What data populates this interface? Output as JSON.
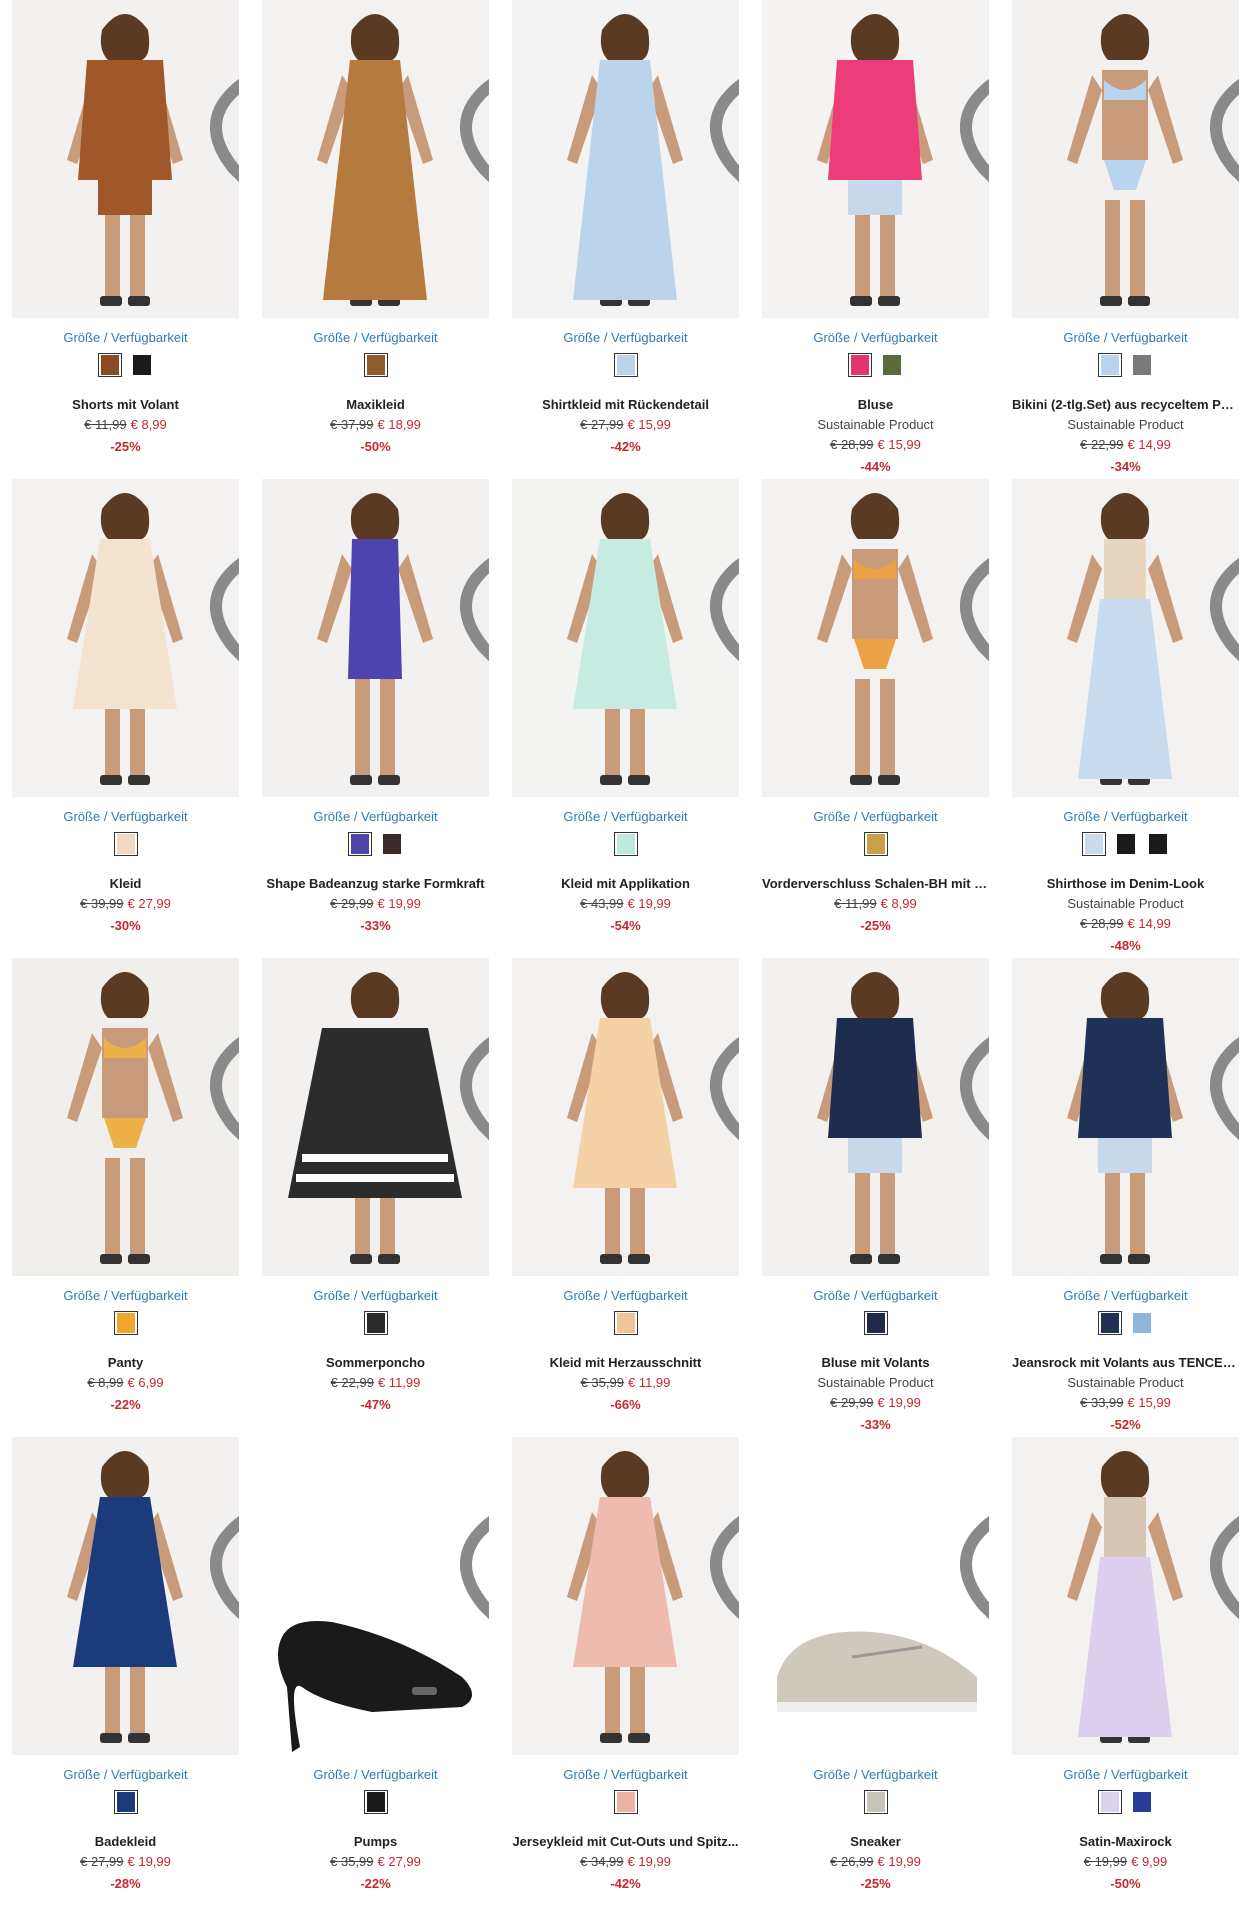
{
  "size_link": "Größe / Verfügbarkeit",
  "products": [
    {
      "name": "Shorts mit Volant",
      "old": "€ 11,99",
      "new": "€ 8,99",
      "disc": "-25%",
      "badge": "",
      "colors": [
        "#8a4a22",
        "#1a1a1a"
      ],
      "main": "#a0582b",
      "bg": "#f2f1ef"
    },
    {
      "name": "Maxikleid",
      "old": "€ 37,99",
      "new": "€ 18,99",
      "disc": "-50%",
      "badge": "",
      "colors": [
        "#8f5a2c"
      ],
      "main": "#b47a3e",
      "bg": "#f3f2f0"
    },
    {
      "name": "Shirtkleid mit Rückendetail",
      "old": "€ 27,99",
      "new": "€ 15,99",
      "disc": "-42%",
      "badge": "",
      "colors": [
        "#bcd3ec"
      ],
      "main": "#bcd3ec",
      "bg": "#f3f3f3"
    },
    {
      "name": "Bluse",
      "old": "€ 28,99",
      "new": "€ 15,99",
      "disc": "-44%",
      "badge": "Sustainable Product",
      "colors": [
        "#e2356b",
        "#5a6a3a"
      ],
      "main": "#ec3c7a",
      "bg": "#f4f3f2"
    },
    {
      "name": "Bikini (2-tlg.Set) aus recyceltem Po...",
      "old": "€ 22,99",
      "new": "€ 14,99",
      "disc": "-34%",
      "badge": "Sustainable Product",
      "colors": [
        "#b9d4ef",
        "#7a7a7a"
      ],
      "main": "#b9d4ef",
      "bg": "#f2f1ef"
    },
    {
      "name": "Kleid",
      "old": "€ 39,99",
      "new": "€ 27,99",
      "disc": "-30%",
      "badge": "",
      "colors": [
        "#f1d7c4"
      ],
      "main": "#f3e3cf",
      "bg": "#f3f2f0"
    },
    {
      "name": "Shape Badeanzug starke Formkraft",
      "old": "€ 29,99",
      "new": "€ 19,99",
      "disc": "-33%",
      "badge": "",
      "colors": [
        "#4f45a8",
        "#3a2a2a"
      ],
      "main": "#4e44b0",
      "bg": "#f2f1ef"
    },
    {
      "name": "Kleid mit Applikation",
      "old": "€ 43,99",
      "new": "€ 19,99",
      "disc": "-54%",
      "badge": "",
      "colors": [
        "#bfe9df"
      ],
      "main": "#c6ece2",
      "bg": "#f3f3f2"
    },
    {
      "name": "Vorderverschluss Schalen-BH mit B...",
      "old": "€ 11,99",
      "new": "€ 8,99",
      "disc": "-25%",
      "badge": "",
      "colors": [
        "#c8a24a"
      ],
      "main": "#e9a344",
      "bg": "#f3f2f0"
    },
    {
      "name": "Shirthose im Denim-Look",
      "old": "€ 28,99",
      "new": "€ 14,99",
      "disc": "-48%",
      "badge": "Sustainable Product",
      "colors": [
        "#c9dcef",
        "#1a1a1a",
        "#1a1a1a"
      ],
      "main": "#c9dcef",
      "bg": "#f3f2f0"
    },
    {
      "name": "Panty",
      "old": "€ 8,99",
      "new": "€ 6,99",
      "disc": "-22%",
      "badge": "",
      "colors": [
        "#f0a52b"
      ],
      "main": "#eeb14a",
      "bg": "#f1efec"
    },
    {
      "name": "Sommerponcho",
      "old": "€ 22,99",
      "new": "€ 11,99",
      "disc": "-47%",
      "badge": "",
      "colors": [
        "#2a2a2a"
      ],
      "main": "#2c2c2c",
      "bg": "#f2f1ef"
    },
    {
      "name": "Kleid mit Herzausschnitt",
      "old": "€ 35,99",
      "new": "€ 11,99",
      "disc": "-66%",
      "badge": "",
      "colors": [
        "#f2c49a"
      ],
      "main": "#f4d1a6",
      "bg": "#f3f2f0"
    },
    {
      "name": "Bluse mit Volants",
      "old": "€ 29,99",
      "new": "€ 19,99",
      "disc": "-33%",
      "badge": "Sustainable Product",
      "colors": [
        "#1f2a4c"
      ],
      "main": "#1e2c4e",
      "bg": "#f2f1ef"
    },
    {
      "name": "Jeansrock mit Volants aus TENCEL...",
      "old": "€ 33,99",
      "new": "€ 15,99",
      "disc": "-52%",
      "badge": "Sustainable Product",
      "colors": [
        "#1f3154",
        "#8eb6d9"
      ],
      "main": "#1f3154",
      "bg": "#f3f2f0"
    },
    {
      "name": "Badekleid",
      "old": "€ 27,99",
      "new": "€ 19,99",
      "disc": "-28%",
      "badge": "",
      "colors": [
        "#1b3a7a"
      ],
      "main": "#1c3b7c",
      "bg": "#f2f1ef"
    },
    {
      "name": "Pumps",
      "old": "€ 35,99",
      "new": "€ 27,99",
      "disc": "-22%",
      "badge": "",
      "colors": [
        "#1a1a1a"
      ],
      "main": "#1a1a1a",
      "bg": "#ffffff"
    },
    {
      "name": "Jerseykleid mit Cut-Outs und Spitz...",
      "old": "€ 34,99",
      "new": "€ 19,99",
      "disc": "-42%",
      "badge": "",
      "colors": [
        "#e9b3a6"
      ],
      "main": "#eebcae",
      "bg": "#f3f2f0"
    },
    {
      "name": "Sneaker",
      "old": "€ 26,99",
      "new": "€ 19,99",
      "disc": "-25%",
      "badge": "",
      "colors": [
        "#c9c4b8"
      ],
      "main": "#cfc9bd",
      "bg": "#ffffff"
    },
    {
      "name": "Satin-Maxirock",
      "old": "€ 19,99",
      "new": "€ 9,99",
      "disc": "-50%",
      "badge": "",
      "colors": [
        "#ddd2ee",
        "#2a3b9a"
      ],
      "main": "#ddd0ef",
      "bg": "#f3f2f0"
    }
  ]
}
